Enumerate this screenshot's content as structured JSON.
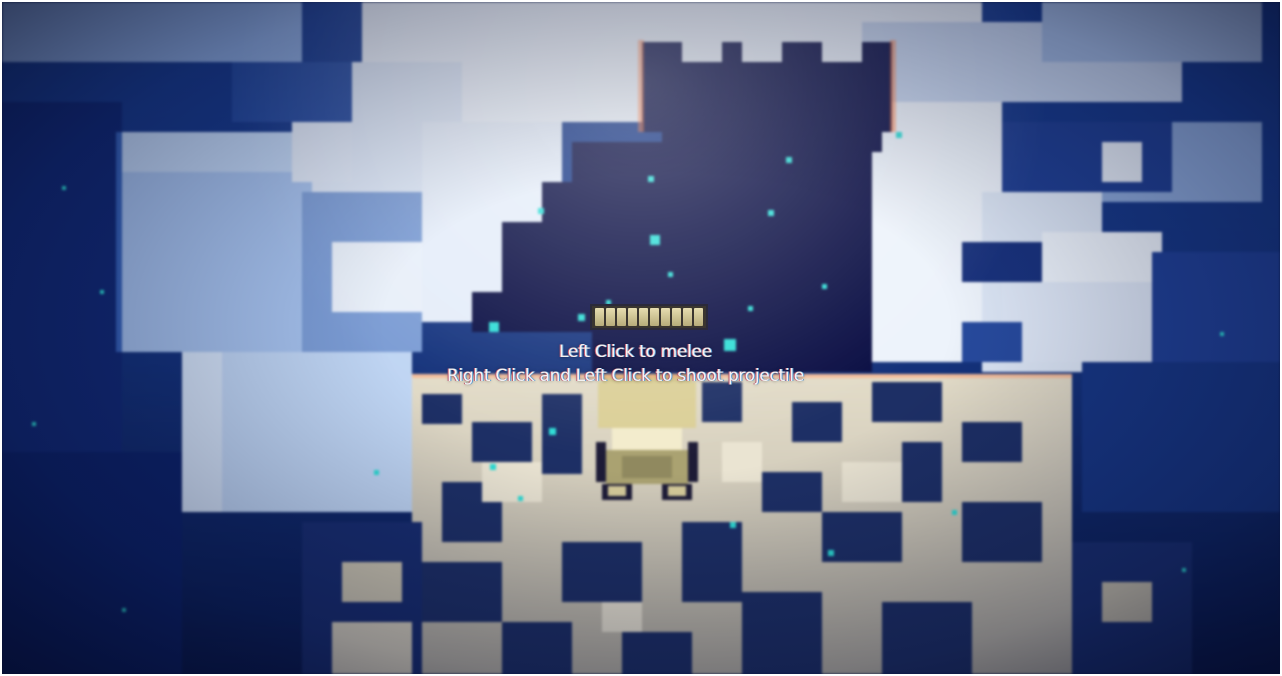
{
  "hud": {
    "ammo": {
      "current": 10,
      "max": 10
    },
    "hints": {
      "melee": "Left Click to melee",
      "projectile": "Right Click  and Left Click to shoot projectile"
    }
  },
  "colors": {
    "sky_dark": "#0b0f3a",
    "void_blue": "#0d1d4f",
    "pixel_light": "#e8eef6",
    "pixel_mid": "#9fb4d6",
    "floor_tan": "#cfc8b4",
    "particle_teal": "#3fd6d0",
    "player_beige": "#d9cf9e"
  },
  "icons": {
    "player": "pixel-hero-sprite",
    "ammo": "ammo-pip-icon",
    "particle": "glitch-particle-icon"
  }
}
